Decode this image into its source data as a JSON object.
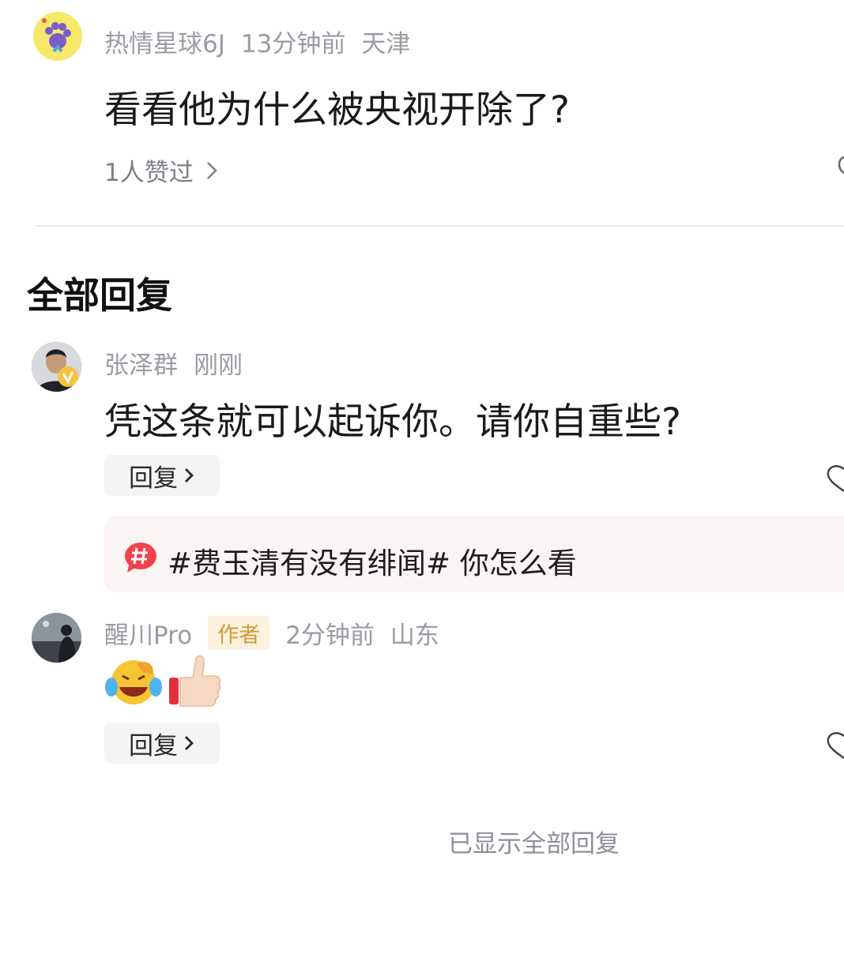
{
  "top_comment": {
    "username": "热情星球6J",
    "time": "13分钟前",
    "location": "天津",
    "text": "看看他为什么被央视开除了?",
    "likes_label": "1人赞过"
  },
  "section_title": "全部回复",
  "replies": [
    {
      "username": "张泽群",
      "time": "刚刚",
      "text": "凭这条就可以起诉你。请你自重些?",
      "reply_label": "回复"
    },
    {
      "username": "醒川Pro",
      "author_badge": "作者",
      "time": "2分钟前",
      "location": "山东",
      "reply_label": "回复"
    }
  ],
  "topic_card": {
    "text": "#费玉清有没有绯闻# 你怎么看"
  },
  "footer": {
    "end_label": "已显示全部回复"
  },
  "icons": {
    "chevron": "chevron-right-icon",
    "like": "heart-icon",
    "topic": "hashtag-bubble-icon",
    "emoji_1": "laughing-crying-emoji-icon",
    "emoji_2": "thumbs-up-emoji-icon"
  },
  "colors": {
    "topic_badge": "#f2424d",
    "author_badge_bg": "#fbf1dc",
    "author_badge_text": "#d39b3a",
    "meta_text": "#9b9ba3"
  }
}
